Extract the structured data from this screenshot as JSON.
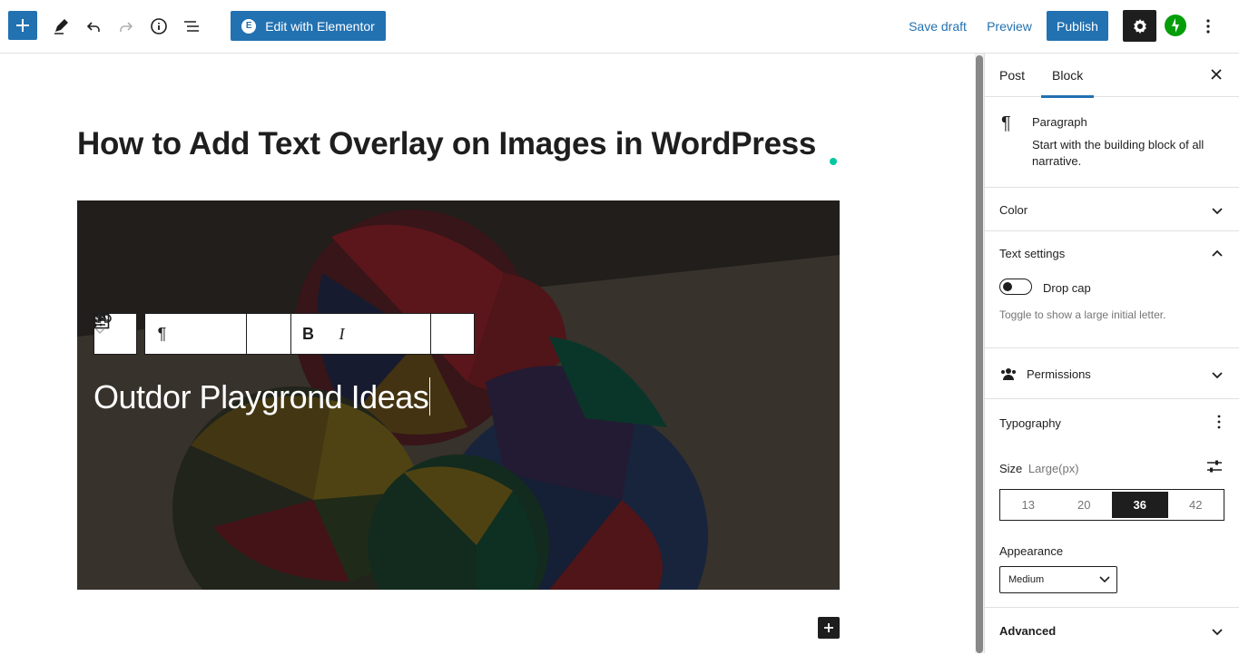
{
  "toolbar": {
    "elementor_label": "Edit with Elementor",
    "save_draft": "Save draft",
    "preview": "Preview",
    "publish": "Publish"
  },
  "post": {
    "title": "How to Add Text Overlay on Images in WordPress",
    "cover_text": "Outdor Playgrond Ideas"
  },
  "sidebar": {
    "tabs": [
      "Post",
      "Block"
    ],
    "active_tab": "Block",
    "block": {
      "name": "Paragraph",
      "description": "Start with the building block of all narrative."
    },
    "color_label": "Color",
    "text_settings": {
      "title": "Text settings",
      "drop_cap_label": "Drop cap",
      "drop_cap_help": "Toggle to show a large initial letter."
    },
    "permissions_label": "Permissions",
    "typography": {
      "title": "Typography",
      "size_label": "Size",
      "size_value": "Large(px)",
      "sizes": [
        "13",
        "20",
        "36",
        "42"
      ],
      "selected_size": "36",
      "appearance_label": "Appearance",
      "appearance_value": "Medium"
    },
    "advanced_label": "Advanced"
  },
  "colors": {
    "accent": "#2271b1",
    "dark": "#1e1e1e",
    "jetpack": "#069e08"
  }
}
